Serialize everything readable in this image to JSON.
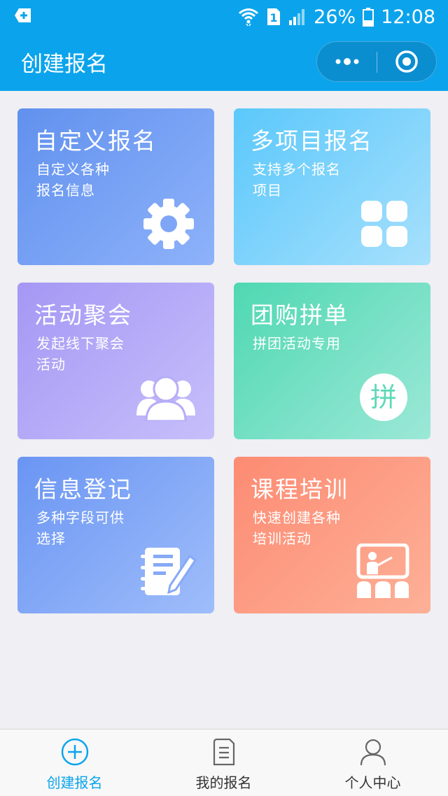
{
  "status_bar": {
    "battery_percent": "26%",
    "time": "12:08",
    "sim_slot": "1",
    "icons": [
      "notification-icon",
      "wifi-icon",
      "sim-icon",
      "signal-icon",
      "battery-icon"
    ]
  },
  "header": {
    "title": "创建报名",
    "capsule": {
      "more_icon": "more-dots-icon",
      "close_icon": "target-icon"
    }
  },
  "cards": [
    {
      "title": "自定义报名",
      "desc_line1": "自定义各种",
      "desc_line2": "报名信息",
      "icon": "gear-icon"
    },
    {
      "title": "多项目报名",
      "desc_line1": "支持多个报名",
      "desc_line2": "项目",
      "icon": "grid-icon"
    },
    {
      "title": "活动聚会",
      "desc_line1": "发起线下聚会",
      "desc_line2": "活动",
      "icon": "group-icon"
    },
    {
      "title": "团购拼单",
      "desc_line1": "拼团活动专用",
      "desc_line2": "",
      "icon": "pin-badge-icon",
      "badge_text": "拼"
    },
    {
      "title": "信息登记",
      "desc_line1": "多种字段可供",
      "desc_line2": "选择",
      "icon": "notebook-pen-icon"
    },
    {
      "title": "课程培训",
      "desc_line1": "快速创建各种",
      "desc_line2": "培训活动",
      "icon": "classroom-icon"
    }
  ],
  "tabbar": {
    "tabs": [
      {
        "label": "创建报名",
        "icon": "add-circle-icon",
        "active": true
      },
      {
        "label": "我的报名",
        "icon": "document-icon",
        "active": false
      },
      {
        "label": "个人中心",
        "icon": "person-icon",
        "active": false
      }
    ]
  },
  "colors": {
    "primary": "#0ba4ec",
    "background": "#efeff4",
    "tab_inactive": "#333333"
  }
}
